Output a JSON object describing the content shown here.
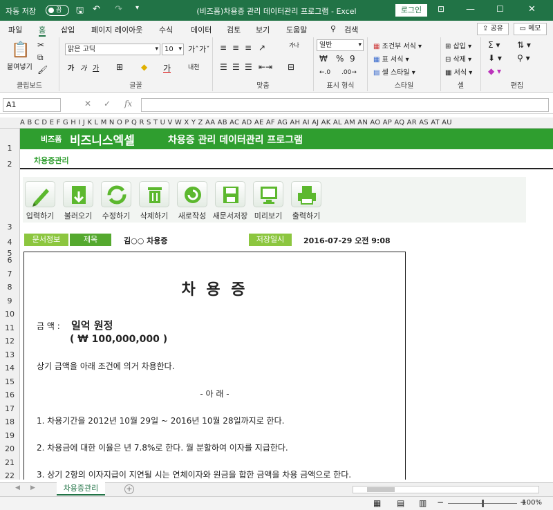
{
  "titlebar": {
    "autosave_label": "자동 저장",
    "autosave_state": "끔",
    "title": "(비즈폼)차용증 관리 데이터관리 프로그램  -  Excel",
    "login_label": "로그인"
  },
  "menu": {
    "tabs": [
      "파일",
      "홈",
      "삽입",
      "페이지 레이아웃",
      "수식",
      "데이터",
      "검토",
      "보기",
      "도움말"
    ],
    "active_tab": "홈",
    "search_label": "검색",
    "share_label": "공유",
    "memo_label": "메모"
  },
  "ribbon": {
    "groups": {
      "clipboard": "클립보드",
      "font": "글꼴",
      "alignment": "맞춤",
      "number": "표시 형식",
      "styles": "스타일",
      "cells": "셀",
      "editing": "편집"
    },
    "paste_label": "붙여넣기",
    "font_name": "맑은 고딕",
    "font_size": "10",
    "number_format": "일반",
    "styles_items": [
      "조건부 서식",
      "표 서식",
      "셀 스타일"
    ],
    "cells_items": [
      "삽입",
      "삭제",
      "서식"
    ],
    "font_buttons": [
      "가",
      "가",
      "가"
    ],
    "wrap_label": "가나"
  },
  "formula_bar": {
    "name_box": "A1",
    "fx_label": "fx",
    "content": ""
  },
  "grid": {
    "columns": "A B C D E F G H I J K L M N O P Q R S T U V W X Y Z AA AB AC AD AE AF AG AH AI AJ AK AL AM AN AO AP AQ AR AS AT AU",
    "rows": [
      "1",
      "2",
      "3",
      "4",
      "5",
      "6",
      "7",
      "8",
      "9",
      "10",
      "11",
      "12",
      "13",
      "14",
      "15",
      "16",
      "17",
      "18",
      "19",
      "20",
      "21",
      "22"
    ]
  },
  "sheet": {
    "brand_small": "비즈폼",
    "brand_big": "비즈니스엑셀",
    "app_title": "차용증 관리 데이터관리 프로그램",
    "sheet_label": "차용증관리",
    "buttons": [
      "입력하기",
      "불러오기",
      "수정하기",
      "삭제하기",
      "새로작성",
      "새문서저장",
      "미리보기",
      "출력하기"
    ],
    "info": {
      "doc_info_label": "문서정보",
      "subject_label": "제목",
      "subject_value": "김○○ 차용증",
      "saved_label": "저장일시",
      "saved_value": "2016-07-29  오전 9:08"
    }
  },
  "document": {
    "title": "차  용  증",
    "amount_label": "금  액 :",
    "amount_korean": "일억 원정",
    "amount_number": "( ₩ 100,000,000 )",
    "intro": "상기 금액을 아래 조건에 의거 차용한다.",
    "below": "- 아          래 -",
    "items": [
      "1. 차용기간을 2012년 10월 29일 ~ 2016년 10월 28일까지로 한다.",
      "2. 차용금에 대한 이율은 년 7.8%로 한다. 월 분할하여 이자를 지급한다.",
      "3. 상기 2항의 이자지급이 지연될 시는 연체이자와 원금을 합한 금액을 차용 금액으로 한다."
    ]
  },
  "sheet_tabs": {
    "active": "차용증관리",
    "add_label": "+"
  },
  "status": {
    "zoom": "100%"
  }
}
